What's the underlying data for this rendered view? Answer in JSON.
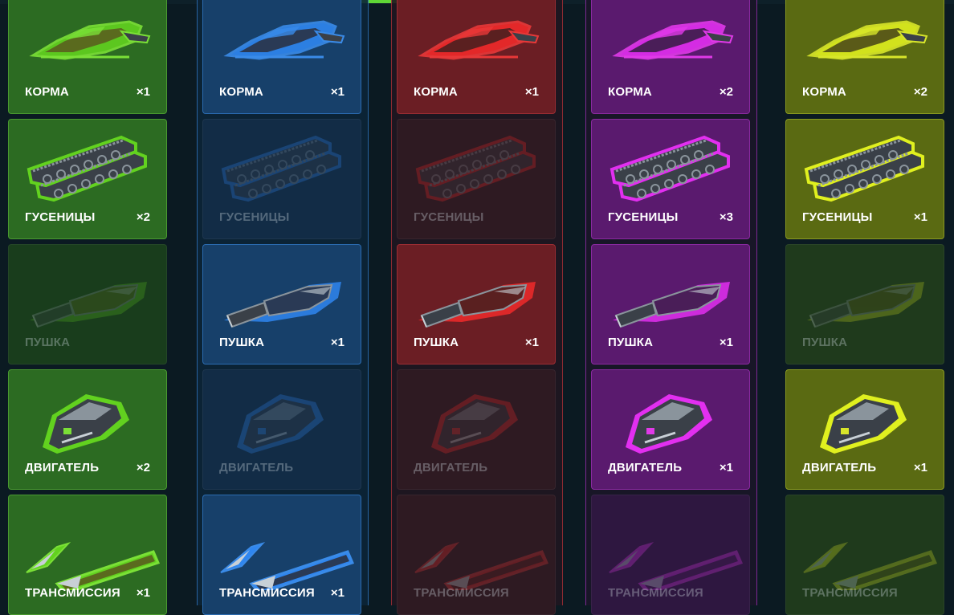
{
  "columns": [
    {
      "id": "green",
      "colors": {
        "accent": "#7be037",
        "card": "#2c6b22",
        "cardDim": "#193d1c",
        "border": "#4a9a30",
        "colBg": "#0b1a22",
        "glow": "#62d21f",
        "body": "#5a6a1e"
      },
      "items": [
        {
          "label": "КОРМА",
          "count": "×1",
          "owned": true,
          "type": "hull"
        },
        {
          "label": "ГУСЕНИЦЫ",
          "count": "×2",
          "owned": true,
          "type": "tracks"
        },
        {
          "label": "ПУШКА",
          "count": "",
          "owned": false,
          "type": "gun"
        },
        {
          "label": "ДВИГАТЕЛЬ",
          "count": "×2",
          "owned": true,
          "type": "engine"
        },
        {
          "label": "ТРАНСМИССИЯ",
          "count": "×1",
          "owned": true,
          "type": "transmission"
        }
      ]
    },
    {
      "id": "blue",
      "colors": {
        "accent": "#3a8be8",
        "card": "#17406a",
        "cardDim": "#122c46",
        "border": "#2b6bb0",
        "colBg": "#0c2438",
        "glow": "#2f86f0",
        "body": "#2a3a55"
      },
      "items": [
        {
          "label": "КОРМА",
          "count": "×1",
          "owned": true,
          "type": "hull"
        },
        {
          "label": "ГУСЕНИЦЫ",
          "count": "",
          "owned": false,
          "type": "tracks"
        },
        {
          "label": "ПУШКА",
          "count": "×1",
          "owned": true,
          "type": "gun"
        },
        {
          "label": "ДВИГАТЕЛЬ",
          "count": "",
          "owned": false,
          "type": "engine"
        },
        {
          "label": "ТРАНСМИССИЯ",
          "count": "×1",
          "owned": true,
          "type": "transmission"
        }
      ]
    },
    {
      "id": "red",
      "colors": {
        "accent": "#e83838",
        "card": "#6b1e24",
        "cardDim": "#2e1a22",
        "border": "#9a2d33",
        "colBg": "#201620",
        "glow": "#f02a2a",
        "body": "#5a2020"
      },
      "items": [
        {
          "label": "КОРМА",
          "count": "×1",
          "owned": true,
          "type": "hull"
        },
        {
          "label": "ГУСЕНИЦЫ",
          "count": "",
          "owned": false,
          "type": "tracks"
        },
        {
          "label": "ПУШКА",
          "count": "×1",
          "owned": true,
          "type": "gun"
        },
        {
          "label": "ДВИГАТЕЛЬ",
          "count": "",
          "owned": false,
          "type": "engine"
        },
        {
          "label": "ТРАНСМИССИЯ",
          "count": "",
          "owned": false,
          "type": "transmission"
        }
      ]
    },
    {
      "id": "purple",
      "colors": {
        "accent": "#e03ae8",
        "card": "#5a1a6e",
        "cardDim": "#2e1740",
        "border": "#8a2aa0",
        "colBg": "#1a1628",
        "glow": "#e22ff0",
        "body": "#4a1e58"
      },
      "items": [
        {
          "label": "КОРМА",
          "count": "×2",
          "owned": true,
          "type": "hull"
        },
        {
          "label": "ГУСЕНИЦЫ",
          "count": "×3",
          "owned": true,
          "type": "tracks"
        },
        {
          "label": "ПУШКА",
          "count": "×1",
          "owned": true,
          "type": "gun"
        },
        {
          "label": "ДВИГАТЕЛЬ",
          "count": "×1",
          "owned": true,
          "type": "engine"
        },
        {
          "label": "ТРАНСМИССИЯ",
          "count": "",
          "owned": false,
          "type": "transmission"
        }
      ]
    },
    {
      "id": "yellow",
      "colors": {
        "accent": "#d8e62a",
        "card": "#5a6a12",
        "cardDim": "#1f3a1c",
        "border": "#8a9a20",
        "colBg": "#0b1a22",
        "glow": "#e0f01f",
        "body": "#5a5a18"
      },
      "items": [
        {
          "label": "КОРМА",
          "count": "×2",
          "owned": true,
          "type": "hull"
        },
        {
          "label": "ГУСЕНИЦЫ",
          "count": "×1",
          "owned": true,
          "type": "tracks"
        },
        {
          "label": "ПУШКА",
          "count": "",
          "owned": false,
          "type": "gun"
        },
        {
          "label": "ДВИГАТЕЛЬ",
          "count": "×1",
          "owned": true,
          "type": "engine"
        },
        {
          "label": "ТРАНСМИССИЯ",
          "count": "",
          "owned": false,
          "type": "transmission"
        }
      ]
    }
  ]
}
